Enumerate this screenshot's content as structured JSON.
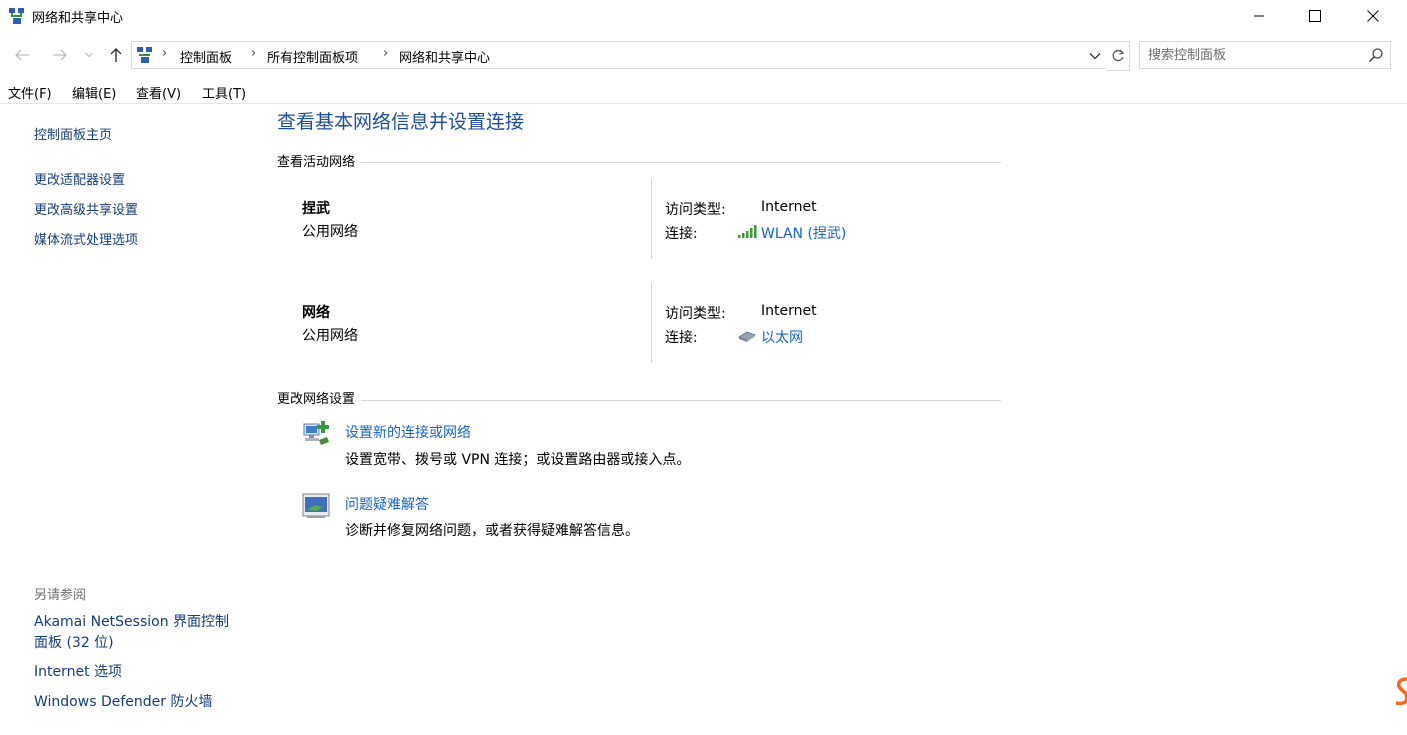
{
  "window": {
    "title": "网络和共享中心",
    "icon": "network-center-icon"
  },
  "address": {
    "breadcrumbs": [
      "控制面板",
      "所有控制面板项",
      "网络和共享中心"
    ],
    "search_placeholder": "搜索控制面板"
  },
  "menu": [
    "文件(F)",
    "编辑(E)",
    "查看(V)",
    "工具(T)"
  ],
  "sidebar": {
    "links": [
      "控制面板主页",
      "更改适配器设置",
      "更改高级共享设置",
      "媒体流式处理选项"
    ],
    "see_also_heading": "另请参阅",
    "see_also": [
      "Akamai NetSession 界面控制",
      "面板 (32 位)",
      "Internet 选项",
      "Windows Defender 防火墙"
    ]
  },
  "main": {
    "title": "查看基本网络信息并设置连接",
    "active_networks_heading": "查看活动网络",
    "networks": [
      {
        "name": "捏武",
        "type": "公用网络",
        "access_label": "访问类型:",
        "access_value": "Internet",
        "connection_label": "连接:",
        "connection_value": "WLAN (捏武)",
        "connection_icon": "wifi-signal-icon"
      },
      {
        "name": "网络",
        "type": "公用网络",
        "access_label": "访问类型:",
        "access_value": "Internet",
        "connection_label": "连接:",
        "connection_value": "以太网",
        "connection_icon": "ethernet-icon"
      }
    ],
    "change_settings_heading": "更改网络设置",
    "tasks": [
      {
        "title": "设置新的连接或网络",
        "description": "设置宽带、拨号或 VPN 连接；或设置路由器或接入点。",
        "icon": "new-connection-icon"
      },
      {
        "title": "问题疑难解答",
        "description": "诊断并修复网络问题，或者获得疑难解答信息。",
        "icon": "troubleshoot-icon"
      }
    ]
  },
  "colors": {
    "link": "#1563c4",
    "title": "#1f4e9a",
    "sidebar_link": "#153d78"
  }
}
